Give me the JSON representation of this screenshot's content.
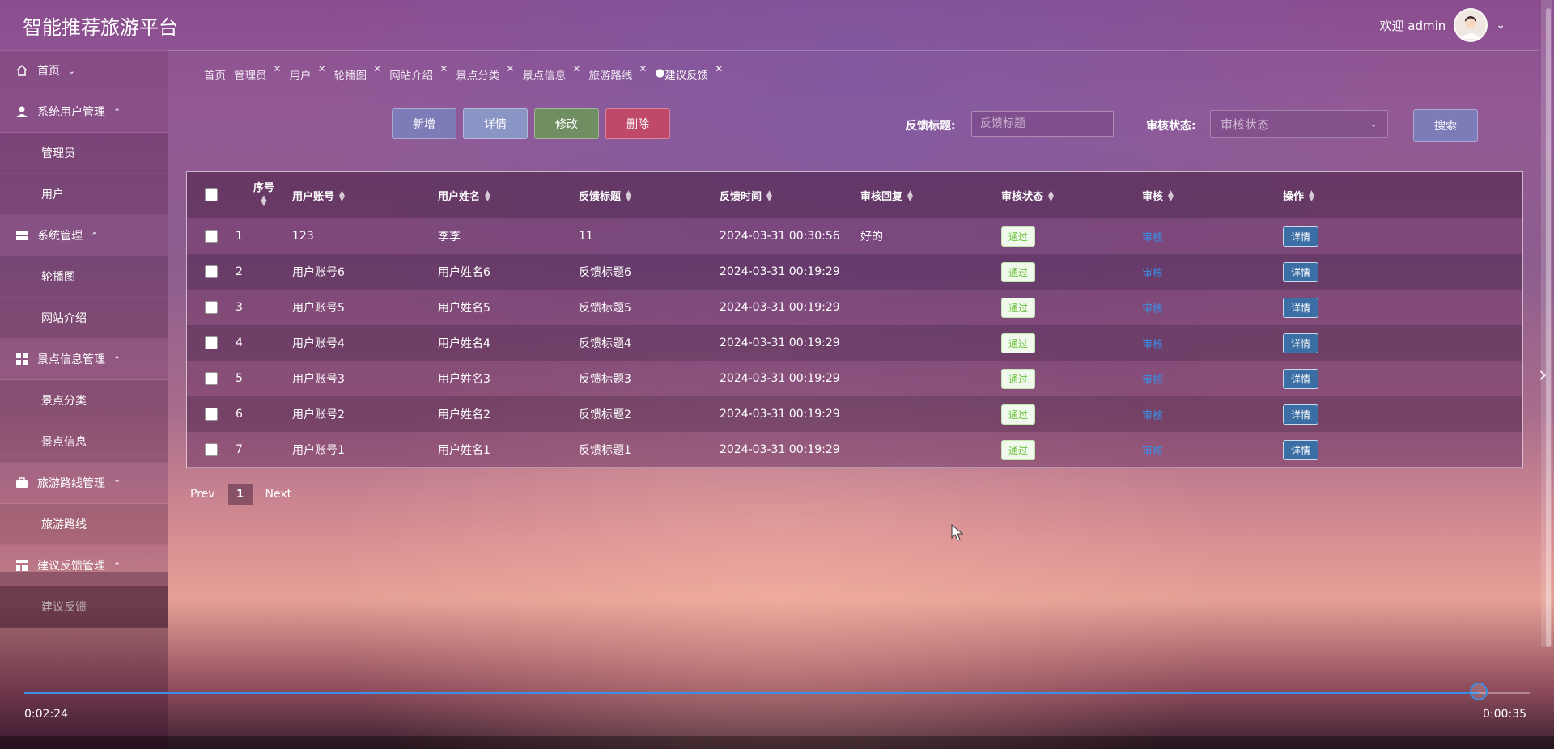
{
  "header": {
    "title": "智能推荐旅游平台",
    "welcome": "欢迎 admin"
  },
  "sidebar": {
    "groups": [
      {
        "label": "首页",
        "icon": "home-icon",
        "items": []
      },
      {
        "label": "系统用户管理",
        "icon": "user-icon",
        "items": [
          "管理员",
          "用户"
        ]
      },
      {
        "label": "系统管理",
        "icon": "server-icon",
        "items": [
          "轮播图",
          "网站介绍"
        ]
      },
      {
        "label": "景点信息管理",
        "icon": "grid-icon",
        "items": [
          "景点分类",
          "景点信息"
        ]
      },
      {
        "label": "旅游路线管理",
        "icon": "briefcase-icon",
        "items": [
          "旅游路线"
        ]
      },
      {
        "label": "建议反馈管理",
        "icon": "layout-icon",
        "items": [
          "建议反馈"
        ]
      }
    ]
  },
  "tabs": [
    {
      "label": "首页",
      "closable": false
    },
    {
      "label": "管理员",
      "closable": true
    },
    {
      "label": "用户",
      "closable": true
    },
    {
      "label": "轮播图",
      "closable": true
    },
    {
      "label": "网站介绍",
      "closable": true
    },
    {
      "label": "景点分类",
      "closable": true
    },
    {
      "label": "景点信息",
      "closable": true
    },
    {
      "label": "旅游路线",
      "closable": true
    },
    {
      "label": "建议反馈",
      "closable": true,
      "active": true
    }
  ],
  "toolbar": {
    "add": "新增",
    "detail": "详情",
    "edit": "修改",
    "delete": "删除",
    "add_color": "#7d7bb8",
    "detail_color": "#8a95c6",
    "edit_color": "#6f8f63",
    "delete_color": "#c04868"
  },
  "search": {
    "title_label": "反馈标题:",
    "title_placeholder": "反馈标题",
    "status_label": "审核状态:",
    "status_placeholder": "审核状态",
    "search_button": "搜索"
  },
  "table": {
    "headers": [
      "序号",
      "用户账号",
      "用户姓名",
      "反馈标题",
      "反馈时间",
      "审核回复",
      "审核状态",
      "审核",
      "操作"
    ],
    "rows": [
      {
        "no": "1",
        "account": "123",
        "name": "李李",
        "title": "11",
        "time": "2024-03-31 00:30:56",
        "reply": "好的",
        "status": "通过",
        "audit": "审核",
        "action": "详情"
      },
      {
        "no": "2",
        "account": "用户账号6",
        "name": "用户姓名6",
        "title": "反馈标题6",
        "time": "2024-03-31 00:19:29",
        "reply": "",
        "status": "通过",
        "audit": "审核",
        "action": "详情"
      },
      {
        "no": "3",
        "account": "用户账号5",
        "name": "用户姓名5",
        "title": "反馈标题5",
        "time": "2024-03-31 00:19:29",
        "reply": "",
        "status": "通过",
        "audit": "审核",
        "action": "详情"
      },
      {
        "no": "4",
        "account": "用户账号4",
        "name": "用户姓名4",
        "title": "反馈标题4",
        "time": "2024-03-31 00:19:29",
        "reply": "",
        "status": "通过",
        "audit": "审核",
        "action": "详情"
      },
      {
        "no": "5",
        "account": "用户账号3",
        "name": "用户姓名3",
        "title": "反馈标题3",
        "time": "2024-03-31 00:19:29",
        "reply": "",
        "status": "通过",
        "audit": "审核",
        "action": "详情"
      },
      {
        "no": "6",
        "account": "用户账号2",
        "name": "用户姓名2",
        "title": "反馈标题2",
        "time": "2024-03-31 00:19:29",
        "reply": "",
        "status": "通过",
        "audit": "审核",
        "action": "详情"
      },
      {
        "no": "7",
        "account": "用户账号1",
        "name": "用户姓名1",
        "title": "反馈标题1",
        "time": "2024-03-31 00:19:29",
        "reply": "",
        "status": "通过",
        "audit": "审核",
        "action": "详情"
      }
    ]
  },
  "pagination": {
    "prev": "Prev",
    "current": "1",
    "next": "Next"
  },
  "video": {
    "elapsed": "0:02:24",
    "remaining": "0:00:35",
    "progress_fraction": 0.966,
    "accent": "#3a8ee6"
  }
}
